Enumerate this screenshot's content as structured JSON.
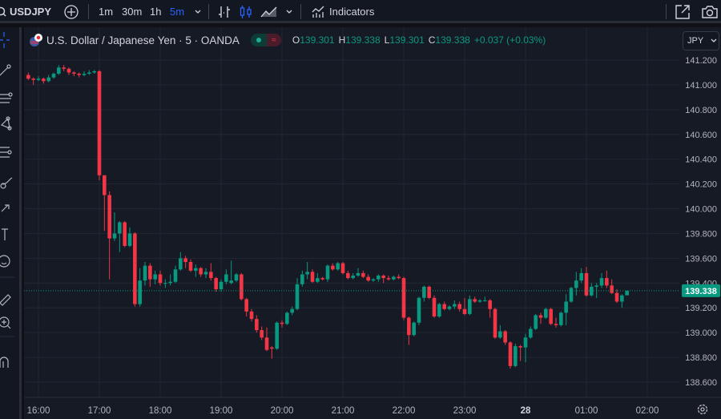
{
  "toolbar": {
    "symbol": "USDJPY",
    "timeframes": [
      "1m",
      "30m",
      "1h",
      "5m"
    ],
    "active_timeframe": "5m",
    "indicators_label": "Indicators"
  },
  "legend": {
    "title": "U.S. Dollar / Japanese Yen · 5 · OANDA",
    "o_label": "O",
    "o": "139.301",
    "h_label": "H",
    "h": "139.338",
    "l_label": "L",
    "l": "139.301",
    "c_label": "C",
    "c": "139.338",
    "change": "+0.037 (+0.03%)"
  },
  "currency": "JPY",
  "colors": {
    "up": "#089981",
    "down": "#f23645",
    "accent": "#2962ff"
  },
  "chart_data": {
    "type": "candlestick",
    "symbol": "USDJPY",
    "interval_minutes": 5,
    "start_time": "15:50",
    "price_ticks": [
      "141.200",
      "141.000",
      "140.800",
      "140.600",
      "140.400",
      "140.200",
      "140.000",
      "139.800",
      "139.600",
      "139.400",
      "139.200",
      "139.000",
      "138.800",
      "138.600"
    ],
    "ylim": [
      138.6,
      141.2
    ],
    "time_ticks": [
      {
        "label": "16:00",
        "min": 0
      },
      {
        "label": "17:00",
        "min": 60
      },
      {
        "label": "18:00",
        "min": 120
      },
      {
        "label": "19:00",
        "min": 180
      },
      {
        "label": "20:00",
        "min": 240
      },
      {
        "label": "21:00",
        "min": 300
      },
      {
        "label": "22:00",
        "min": 360
      },
      {
        "label": "23:00",
        "min": 420
      },
      {
        "label": "28",
        "min": 480
      },
      {
        "label": "01:00",
        "min": 540
      },
      {
        "label": "02:00",
        "min": 600
      }
    ],
    "last_price": "139.338",
    "candles": [
      [
        141.08,
        141.1,
        141.04,
        141.05
      ],
      [
        141.05,
        141.06,
        141.0,
        141.04
      ],
      [
        141.04,
        141.07,
        141.03,
        141.05
      ],
      [
        141.05,
        141.06,
        141.01,
        141.03
      ],
      [
        141.03,
        141.08,
        141.02,
        141.06
      ],
      [
        141.06,
        141.1,
        141.05,
        141.09
      ],
      [
        141.09,
        141.16,
        141.08,
        141.14
      ],
      [
        141.14,
        141.16,
        141.11,
        141.13
      ],
      [
        141.13,
        141.14,
        141.08,
        141.1
      ],
      [
        141.1,
        141.11,
        141.07,
        141.09
      ],
      [
        141.09,
        141.1,
        141.06,
        141.08
      ],
      [
        141.08,
        141.11,
        141.07,
        141.09
      ],
      [
        141.09,
        141.12,
        141.08,
        141.1
      ],
      [
        141.1,
        141.12,
        141.09,
        141.11
      ],
      [
        141.11,
        141.12,
        140.23,
        140.27
      ],
      [
        140.27,
        140.27,
        139.82,
        140.11
      ],
      [
        140.11,
        140.14,
        139.43,
        139.76
      ],
      [
        139.76,
        139.97,
        139.74,
        139.8
      ],
      [
        139.8,
        139.9,
        139.65,
        139.89
      ],
      [
        139.89,
        139.9,
        139.69,
        139.7
      ],
      [
        139.7,
        139.85,
        139.69,
        139.8
      ],
      [
        139.8,
        139.81,
        139.21,
        139.23
      ],
      [
        139.23,
        139.52,
        139.21,
        139.42
      ],
      [
        139.42,
        139.57,
        139.38,
        139.54
      ],
      [
        139.54,
        139.56,
        139.37,
        139.43
      ],
      [
        139.43,
        139.5,
        139.39,
        139.47
      ],
      [
        139.47,
        139.5,
        139.38,
        139.4
      ],
      [
        139.4,
        139.43,
        139.36,
        139.4
      ],
      [
        139.4,
        139.47,
        139.38,
        139.41
      ],
      [
        139.41,
        139.54,
        139.4,
        139.51
      ],
      [
        139.51,
        139.65,
        139.5,
        139.6
      ],
      [
        139.6,
        139.62,
        139.52,
        139.57
      ],
      [
        139.57,
        139.59,
        139.49,
        139.5
      ],
      [
        139.5,
        139.55,
        139.45,
        139.52
      ],
      [
        139.52,
        139.53,
        139.45,
        139.47
      ],
      [
        139.47,
        139.52,
        139.44,
        139.49
      ],
      [
        139.49,
        139.56,
        139.42,
        139.44
      ],
      [
        139.44,
        139.45,
        139.33,
        139.35
      ],
      [
        139.35,
        139.43,
        139.33,
        139.41
      ],
      [
        139.41,
        139.51,
        139.39,
        139.47
      ],
      [
        139.4,
        139.58,
        139.39,
        139.42
      ],
      [
        139.42,
        139.48,
        139.41,
        139.47
      ],
      [
        139.47,
        139.48,
        139.26,
        139.27
      ],
      [
        139.27,
        139.28,
        139.13,
        139.17
      ],
      [
        139.17,
        139.19,
        139.09,
        139.11
      ],
      [
        139.11,
        139.14,
        139.0,
        139.02
      ],
      [
        139.02,
        139.05,
        138.94,
        138.96
      ],
      [
        138.96,
        139.04,
        138.85,
        138.86
      ],
      [
        138.88,
        138.89,
        138.79,
        138.87
      ],
      [
        138.87,
        139.09,
        138.86,
        139.08
      ],
      [
        139.08,
        139.1,
        139.04,
        139.07
      ],
      [
        139.07,
        139.17,
        139.06,
        139.16
      ],
      [
        139.16,
        139.21,
        139.14,
        139.19
      ],
      [
        139.19,
        139.44,
        139.18,
        139.39
      ],
      [
        139.39,
        139.5,
        139.37,
        139.47
      ],
      [
        139.47,
        139.57,
        139.43,
        139.49
      ],
      [
        139.49,
        139.51,
        139.4,
        139.41
      ],
      [
        139.41,
        139.48,
        139.4,
        139.44
      ],
      [
        139.44,
        139.45,
        139.42,
        139.43
      ],
      [
        139.43,
        139.55,
        139.41,
        139.54
      ],
      [
        139.54,
        139.56,
        139.5,
        139.51
      ],
      [
        139.51,
        139.57,
        139.5,
        139.56
      ],
      [
        139.56,
        139.57,
        139.47,
        139.48
      ],
      [
        139.48,
        139.5,
        139.43,
        139.44
      ],
      [
        139.44,
        139.48,
        139.43,
        139.46
      ],
      [
        139.46,
        139.52,
        139.45,
        139.48
      ],
      [
        139.48,
        139.5,
        139.44,
        139.45
      ],
      [
        139.45,
        139.47,
        139.41,
        139.42
      ],
      [
        139.42,
        139.44,
        139.41,
        139.43
      ],
      [
        139.43,
        139.47,
        139.41,
        139.46
      ],
      [
        139.46,
        139.47,
        139.4,
        139.44
      ],
      [
        139.44,
        139.46,
        139.42,
        139.43
      ],
      [
        139.43,
        139.46,
        139.42,
        139.45
      ],
      [
        139.45,
        139.47,
        139.43,
        139.44
      ],
      [
        139.44,
        139.45,
        139.1,
        139.12
      ],
      [
        139.12,
        139.13,
        138.9,
        138.98
      ],
      [
        138.98,
        139.09,
        138.97,
        139.08
      ],
      [
        139.08,
        139.29,
        139.06,
        139.28
      ],
      [
        139.28,
        139.38,
        139.25,
        139.37
      ],
      [
        139.37,
        139.38,
        139.27,
        139.28
      ],
      [
        139.28,
        139.3,
        139.12,
        139.13
      ],
      [
        139.13,
        139.24,
        139.12,
        139.23
      ],
      [
        139.23,
        139.25,
        139.18,
        139.19
      ],
      [
        139.19,
        139.22,
        139.18,
        139.21
      ],
      [
        139.21,
        139.26,
        139.19,
        139.23
      ],
      [
        139.23,
        139.25,
        139.17,
        139.19
      ],
      [
        139.19,
        139.28,
        139.14,
        139.15
      ],
      [
        139.15,
        139.3,
        139.14,
        139.27
      ],
      [
        139.27,
        139.29,
        139.24,
        139.25
      ],
      [
        139.25,
        139.27,
        139.24,
        139.26
      ],
      [
        139.26,
        139.29,
        139.25,
        139.26
      ],
      [
        139.26,
        139.27,
        139.12,
        139.19
      ],
      [
        139.19,
        139.2,
        138.95,
        138.96
      ],
      [
        138.96,
        139.06,
        138.95,
        139.01
      ],
      [
        139.01,
        139.02,
        138.9,
        138.92
      ],
      [
        138.92,
        138.93,
        138.71,
        138.73
      ],
      [
        138.73,
        138.91,
        138.72,
        138.89
      ],
      [
        138.89,
        138.9,
        138.77,
        138.88
      ],
      [
        138.88,
        138.99,
        138.76,
        138.96
      ],
      [
        138.96,
        139.05,
        138.95,
        139.03
      ],
      [
        139.03,
        139.15,
        139.02,
        139.14
      ],
      [
        139.14,
        139.16,
        139.07,
        139.12
      ],
      [
        139.12,
        139.2,
        139.11,
        139.19
      ],
      [
        139.19,
        139.2,
        139.06,
        139.07
      ],
      [
        139.07,
        139.12,
        139.04,
        139.06
      ],
      [
        139.06,
        139.17,
        139.05,
        139.16
      ],
      [
        139.16,
        139.31,
        139.06,
        139.25
      ],
      [
        139.25,
        139.37,
        139.24,
        139.36
      ],
      [
        139.36,
        139.49,
        139.3,
        139.42
      ],
      [
        139.42,
        139.52,
        139.4,
        139.48
      ],
      [
        139.48,
        139.53,
        139.29,
        139.3
      ],
      [
        139.3,
        139.4,
        139.29,
        139.37
      ],
      [
        139.37,
        139.4,
        139.28,
        139.38
      ],
      [
        139.38,
        139.48,
        139.36,
        139.44
      ],
      [
        139.44,
        139.5,
        139.36,
        139.38
      ],
      [
        139.38,
        139.43,
        139.31,
        139.32
      ],
      [
        139.32,
        139.35,
        139.24,
        139.25
      ],
      [
        139.25,
        139.31,
        139.2,
        139.3
      ],
      [
        139.301,
        139.338,
        139.301,
        139.338
      ]
    ]
  }
}
